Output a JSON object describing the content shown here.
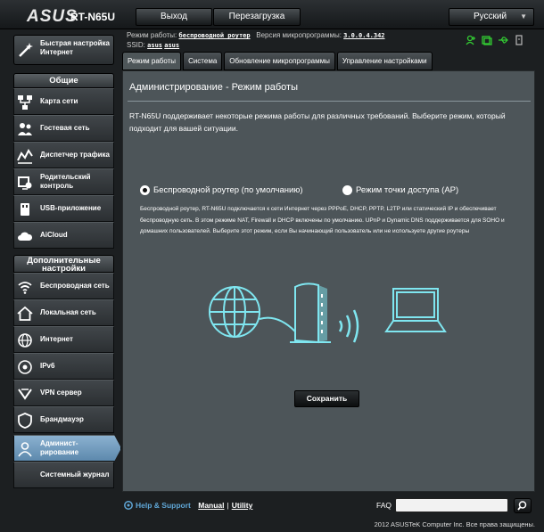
{
  "header": {
    "logo": "ASUS",
    "model": "RT-N65U",
    "logout_label": "Выход",
    "reboot_label": "Перезагрузка",
    "language": "Русский"
  },
  "info": {
    "mode_label": "Режим работы:",
    "mode_value": "беспроводной роутер",
    "firmware_label": "Версия микропрограммы:",
    "firmware_value": "3.0.0.4.342",
    "ssid_label": "SSID:",
    "ssid_1": "asus",
    "ssid_2": "asus"
  },
  "sidebar": {
    "quick_setup": "Быстрая настройка Интернет",
    "general_title": "Общие",
    "general_items": [
      {
        "label": "Карта сети",
        "icon": "network-map-icon"
      },
      {
        "label": "Гостевая сеть",
        "icon": "guest-network-icon"
      },
      {
        "label": "Диспетчер трафика",
        "icon": "traffic-manager-icon"
      },
      {
        "label": "Родительский контроль",
        "icon": "parental-control-icon"
      },
      {
        "label": "USB-приложение",
        "icon": "usb-icon"
      },
      {
        "label": "AiCloud",
        "icon": "cloud-icon"
      }
    ],
    "advanced_title": "Дополнительные настройки",
    "advanced_items": [
      {
        "label": "Беспроводная сеть",
        "icon": "wireless-icon"
      },
      {
        "label": "Локальная сеть",
        "icon": "home-icon"
      },
      {
        "label": "Интернет",
        "icon": "globe-icon"
      },
      {
        "label": "IPv6",
        "icon": "ipv6-icon"
      },
      {
        "label": "VPN сервер",
        "icon": "vpn-icon"
      },
      {
        "label": "Брандмауэр",
        "icon": "firewall-icon"
      },
      {
        "label": "Админист­рирование",
        "icon": "admin-icon"
      },
      {
        "label": "Системный журнал",
        "icon": "log-icon"
      }
    ]
  },
  "tabs": [
    "Режим работы",
    "Система",
    "Обновление микропрограммы",
    "Управление настройками"
  ],
  "page": {
    "title": "Администрирование - Режим работы",
    "description": "RT-N65U поддерживает некоторые режима работы для различных требований. Выберите режим, который подходит для вашей ситуации.",
    "option_router": "Беспроводной роутер (по умолчанию)",
    "option_ap": "Режим точки доступа (AP)",
    "mode_description": "Беспроводной роутер, RT-N65U подключается к сети Интернет через PPPoE, DHCP, PPTP, L2TP или статический IP и обеспечивает беспроводную сеть. В этом режиме NAT, Firewall и DHCP включены по умолчанию. UPnP и Dynamic DNS поддерживается для SOHO и домашних пользователей. Выберите этот режим, если Вы начинающий пользователь или не используете другие роутеры",
    "save_label": "Сохранить"
  },
  "footer": {
    "help": "Help & Support",
    "manual": "Manual",
    "separator": "|",
    "utility": "Utility",
    "faq": "FAQ",
    "copyright": "2012 ASUSTeK Computer Inc. Все права защищены."
  },
  "colors": {
    "accent": "#5fa6d6",
    "active_item": "#7aa3c4",
    "content_bg": "#4d5559",
    "illustration": "#7fe6f0",
    "status_green": "#33cc33"
  }
}
